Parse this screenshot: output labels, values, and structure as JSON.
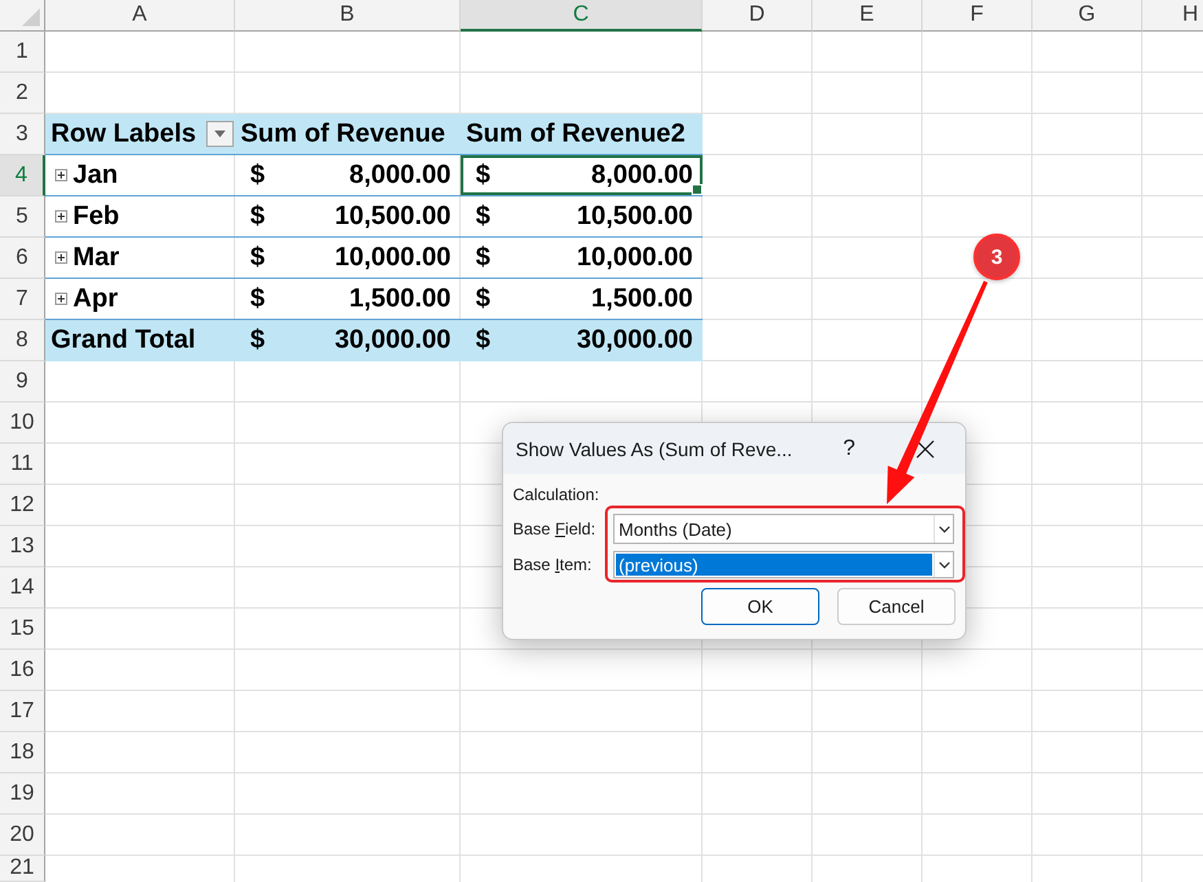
{
  "sheet": {
    "columns": [
      {
        "label": "A",
        "selected": false
      },
      {
        "label": "B",
        "selected": false
      },
      {
        "label": "C",
        "selected": true
      },
      {
        "label": "D",
        "selected": false
      },
      {
        "label": "E",
        "selected": false
      },
      {
        "label": "F",
        "selected": false
      },
      {
        "label": "G",
        "selected": false
      },
      {
        "label": "H",
        "selected": false
      }
    ],
    "rows": [
      {
        "number": "1",
        "selected": false,
        "kind": "blank"
      },
      {
        "number": "2",
        "selected": false,
        "kind": "blank"
      },
      {
        "number": "3",
        "selected": false,
        "kind": "pivot_header",
        "headers": [
          {
            "label": "Row Labels",
            "filter": true
          },
          {
            "label": "Sum of Revenue",
            "filter": false
          },
          {
            "label": "Sum of Revenue2",
            "filter": false
          }
        ]
      },
      {
        "number": "4",
        "selected": true,
        "kind": "pivot_item",
        "label": "Jan",
        "expanded": false,
        "values": [
          {
            "currency": "$",
            "amount": "8,000.00",
            "selected": false
          },
          {
            "currency": "$",
            "amount": "8,000.00",
            "selected": true
          }
        ]
      },
      {
        "number": "5",
        "selected": false,
        "kind": "pivot_item",
        "label": "Feb",
        "expanded": false,
        "values": [
          {
            "currency": "$",
            "amount": "10,500.00",
            "selected": false
          },
          {
            "currency": "$",
            "amount": "10,500.00",
            "selected": false
          }
        ]
      },
      {
        "number": "6",
        "selected": false,
        "kind": "pivot_item",
        "label": "Mar",
        "expanded": false,
        "values": [
          {
            "currency": "$",
            "amount": "10,000.00",
            "selected": false
          },
          {
            "currency": "$",
            "amount": "10,000.00",
            "selected": false
          }
        ]
      },
      {
        "number": "7",
        "selected": false,
        "kind": "pivot_item",
        "label": "Apr",
        "expanded": false,
        "values": [
          {
            "currency": "$",
            "amount": "1,500.00",
            "selected": false
          },
          {
            "currency": "$",
            "amount": "1,500.00",
            "selected": false
          }
        ]
      },
      {
        "number": "8",
        "selected": false,
        "kind": "pivot_total",
        "label": "Grand Total",
        "values": [
          {
            "currency": "$",
            "amount": "30,000.00",
            "selected": false
          },
          {
            "currency": "$",
            "amount": "30,000.00",
            "selected": false
          }
        ]
      },
      {
        "number": "9",
        "selected": false,
        "kind": "blank"
      },
      {
        "number": "10",
        "selected": false,
        "kind": "blank"
      },
      {
        "number": "11",
        "selected": false,
        "kind": "blank"
      },
      {
        "number": "12",
        "selected": false,
        "kind": "blank"
      },
      {
        "number": "13",
        "selected": false,
        "kind": "blank"
      },
      {
        "number": "14",
        "selected": false,
        "kind": "blank"
      },
      {
        "number": "15",
        "selected": false,
        "kind": "blank"
      },
      {
        "number": "16",
        "selected": false,
        "kind": "blank"
      },
      {
        "number": "17",
        "selected": false,
        "kind": "blank"
      },
      {
        "number": "18",
        "selected": false,
        "kind": "blank"
      },
      {
        "number": "19",
        "selected": false,
        "kind": "blank"
      },
      {
        "number": "20",
        "selected": false,
        "kind": "blank"
      },
      {
        "number": "21",
        "selected": false,
        "kind": "blank"
      }
    ]
  },
  "dialog": {
    "title": "Show Values As (Sum of Reve...",
    "help": "?",
    "calculation_label": "Calculation:",
    "fields": [
      {
        "label_parts": [
          "Base ",
          "F",
          "ield:"
        ],
        "value": "Months (Date)",
        "highlighted": false
      },
      {
        "label_parts": [
          "Base ",
          "I",
          "tem:"
        ],
        "value": "(previous)",
        "highlighted": true
      }
    ],
    "buttons": [
      {
        "label": "OK",
        "default": true
      },
      {
        "label": "Cancel",
        "default": false
      }
    ]
  },
  "annotation": {
    "label": "3"
  }
}
